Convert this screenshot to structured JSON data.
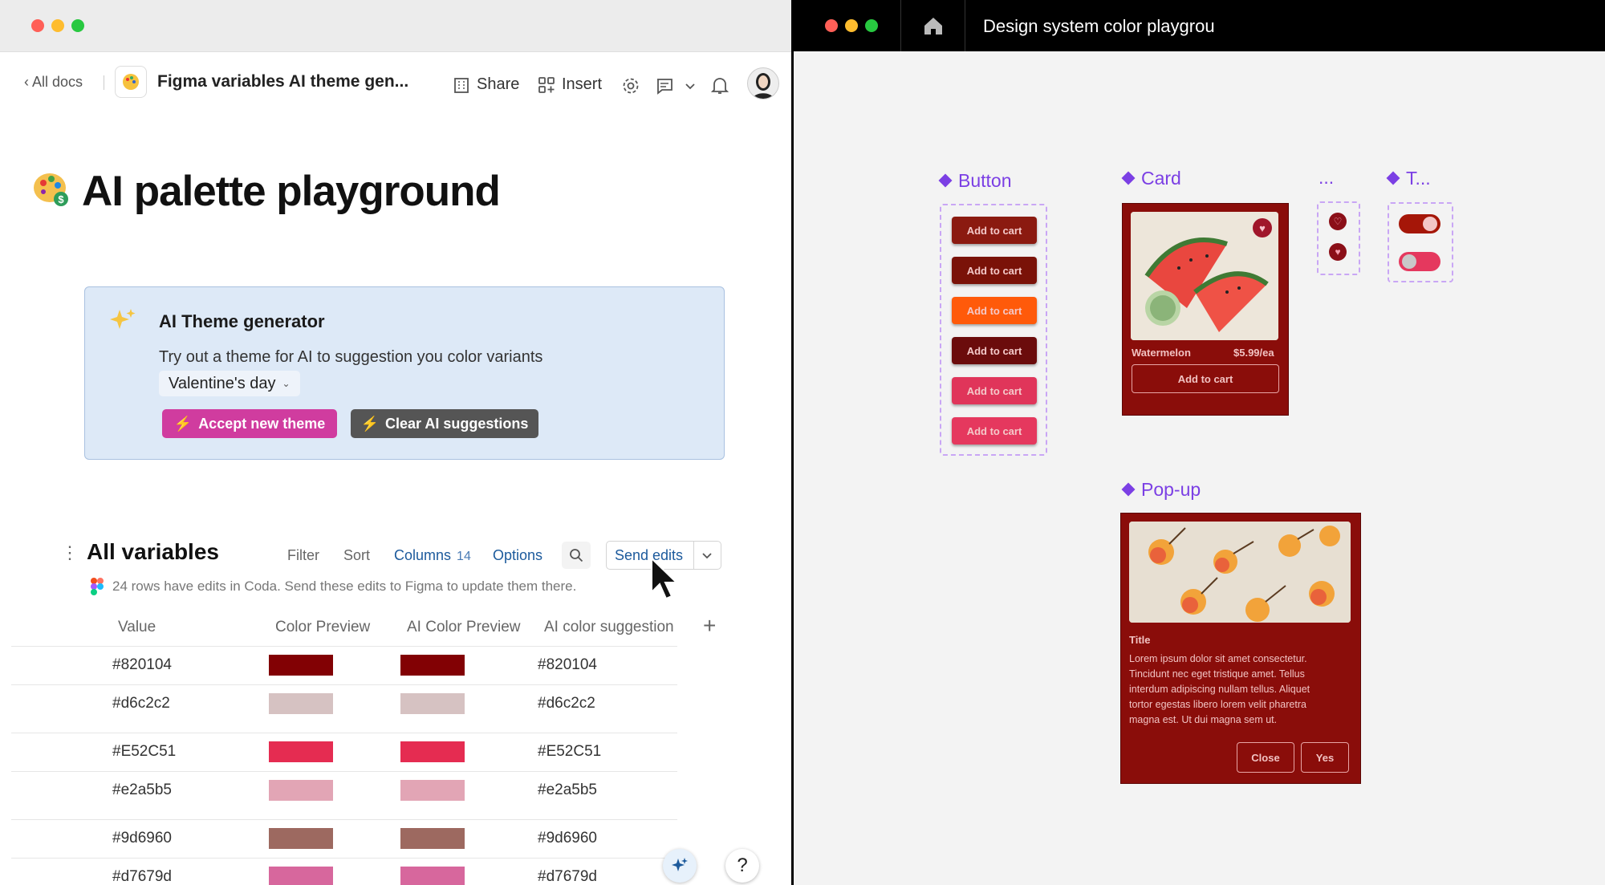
{
  "left_window": {
    "doc_header": {
      "back_link": "All docs",
      "doc_title": "Figma variables AI theme gen...",
      "share_label": "Share",
      "insert_label": "Insert"
    },
    "page_title": "AI palette playground",
    "ai_panel": {
      "title": "AI Theme generator",
      "description": "Try out a theme for AI to suggestion you color variants",
      "theme_select": "Valentine's day",
      "accept_label": "Accept new theme",
      "clear_label": "Clear AI suggestions",
      "accept_color": "#d03c9f",
      "clear_color": "#555555",
      "panel_bg": "#dde9f7"
    },
    "table": {
      "title": "All variables",
      "filter_label": "Filter",
      "sort_label": "Sort",
      "columns_label": "Columns",
      "columns_count": "14",
      "options_label": "Options",
      "send_edits_label": "Send edits",
      "notice": "24 rows have edits in Coda. Send these edits to Figma to update them there.",
      "headers": [
        "Value",
        "Color Preview",
        "AI Color Preview",
        "AI color suggestion"
      ],
      "rows": [
        {
          "value": "#820104",
          "preview": "#820104",
          "ai_preview": "#820104",
          "suggestion": "#820104"
        },
        {
          "value": "#d6c2c2",
          "preview": "#d6c2c2",
          "ai_preview": "#d6c2c2",
          "suggestion": "#d6c2c2"
        },
        {
          "value": "#E52C51",
          "preview": "#E52C51",
          "ai_preview": "#E52C51",
          "suggestion": "#E52C51"
        },
        {
          "value": "#e2a5b5",
          "preview": "#e2a5b5",
          "ai_preview": "#e2a5b5",
          "suggestion": "#e2a5b5"
        },
        {
          "value": "#9d6960",
          "preview": "#9d6960",
          "ai_preview": "#9d6960",
          "suggestion": "#9d6960"
        },
        {
          "value": "#d7679d",
          "preview": "#d7679d",
          "ai_preview": "#d7679d",
          "suggestion": "#d7679d"
        }
      ]
    },
    "help_label": "?"
  },
  "right_window": {
    "title": "Design system color playgrou",
    "components": {
      "button_label": "Button",
      "card_label": "Card",
      "ellipsis_label": "...",
      "toggle_label": "T...",
      "popup_label": "Pop-up"
    },
    "cart_buttons": [
      {
        "label": "Add to cart",
        "color": "#8b1a10"
      },
      {
        "label": "Add to cart",
        "color": "#7a1208"
      },
      {
        "label": "Add to cart",
        "color": "#ff5a0a"
      },
      {
        "label": "Add to cart",
        "color": "#6b0c0c"
      },
      {
        "label": "Add to cart",
        "color": "#e0355a"
      },
      {
        "label": "Add to cart",
        "color": "#e5385e"
      }
    ],
    "card": {
      "product": "Watermelon",
      "price": "$5.99/ea",
      "cta": "Add to cart",
      "bg": "#8a0d0a"
    },
    "popup": {
      "title": "Title",
      "body": "Lorem ipsum dolor sit amet consectetur. Tincidunt nec eget tristique amet. Tellus interdum adipiscing nullam tellus. Aliquet tortor egestas libero lorem velit pharetra magna est. Ut dui magna sem ut.",
      "close_label": "Close",
      "yes_label": "Yes",
      "bg": "#8a0d0a"
    }
  }
}
